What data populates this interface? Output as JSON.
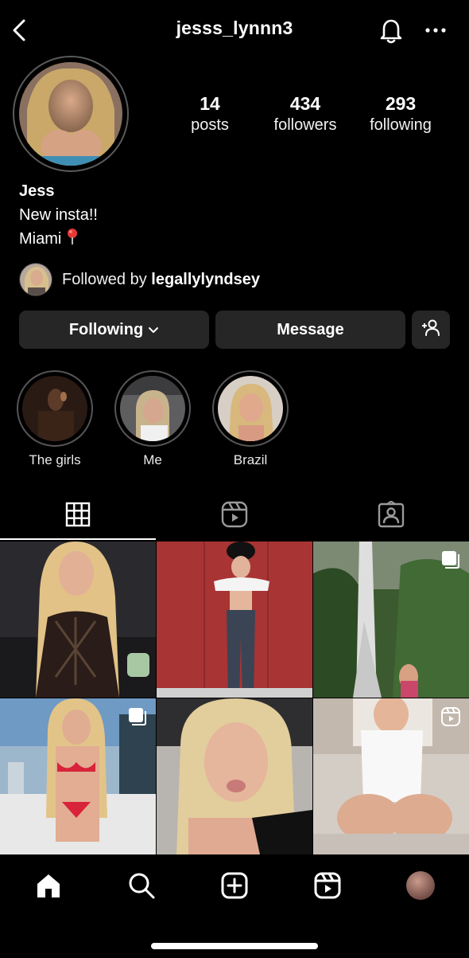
{
  "header": {
    "username": "jesss_lynnn3"
  },
  "profile": {
    "stats": [
      {
        "value": "14",
        "label": "posts"
      },
      {
        "value": "434",
        "label": "followers"
      },
      {
        "value": "293",
        "label": "following"
      }
    ],
    "name": "Jess",
    "bio_line1": "New insta!!",
    "bio_line2": "Miami",
    "followed_by_prefix": "Followed by ",
    "followed_by_user": "legallylyndsey"
  },
  "actions": {
    "following_label": "Following",
    "message_label": "Message"
  },
  "highlights": [
    {
      "label": "The girls"
    },
    {
      "label": "Me"
    },
    {
      "label": "Brazil"
    }
  ],
  "tabs": [
    "grid-icon",
    "reels-icon",
    "tagged-icon"
  ],
  "bottom_nav": [
    "home-icon",
    "search-icon",
    "new-post-icon",
    "reels-icon",
    "profile-avatar"
  ],
  "colors": {
    "background": "#000000",
    "button": "#262626",
    "text": "#ffffff"
  }
}
